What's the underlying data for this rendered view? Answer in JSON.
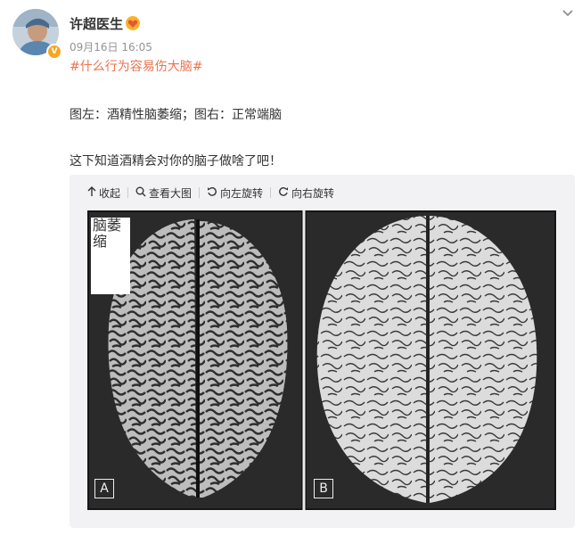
{
  "post": {
    "user_name": "许超医生",
    "time": "09月16日 16:05",
    "hashtag": "#什么行为容易伤大脑#",
    "lines": [
      "图左：酒精性脑萎缩；图右：正常端脑",
      "这下知道酒精会对你的脑子做啥了吧！"
    ]
  },
  "media": {
    "toolbar": {
      "collapse": "收起",
      "view_large": "查看大图",
      "rotate_left": "向左旋转",
      "rotate_right": "向右旋转"
    },
    "image": {
      "label_text": "脑萎缩",
      "panel_a": "A",
      "panel_b": "B"
    }
  },
  "colors": {
    "hashtag": "#eb7350",
    "verified_badge": "#f5a623",
    "media_background": "#f2f2f5"
  },
  "icons": [
    "verified-badge-icon",
    "vip-badge-icon",
    "chevron-down-icon",
    "arrow-up-icon",
    "magnifier-icon",
    "rotate-left-icon",
    "rotate-right-icon"
  ]
}
